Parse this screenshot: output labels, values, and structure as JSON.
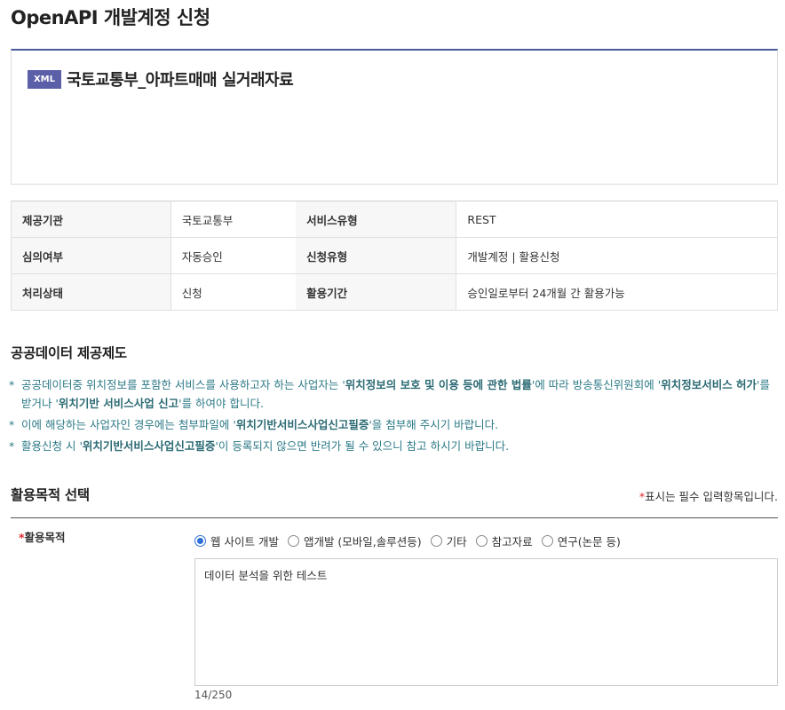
{
  "page": {
    "title": "OpenAPI 개발계정 신청"
  },
  "service": {
    "badge": "XML",
    "name": "국토교통부_아파트매매 실거래자료"
  },
  "info_table": {
    "rows": [
      {
        "label1": "제공기관",
        "value1": "국토교통부",
        "label2": "서비스유형",
        "value2": "REST"
      },
      {
        "label1": "심의여부",
        "value1": "자동승인",
        "label2": "신청유형",
        "value2": "개발계정 | 활용신청"
      },
      {
        "label1": "처리상태",
        "value1": "신청",
        "label2": "활용기간",
        "value2": "승인일로부터 24개월 간 활용가능"
      }
    ]
  },
  "policy": {
    "title": "공공데이터 제공제도",
    "star": "*",
    "notice1": {
      "t1": "공공데이터중 위치정보를 포함한 서비스를 사용하고자 하는 사업자는 '",
      "b1": "위치정보의 보호 및 이용 등에 관한 법률",
      "t2": "'에 따라 방송통신위원회에 '",
      "b2": "위치정보서비스 허가",
      "t3": "'를 받거나 '",
      "b3": "위치기반 서비스사업 신고",
      "t4": "'를 하여야 합니다."
    },
    "notice2": {
      "t1": "이에 해당하는 사업자인 경우에는 첨부파일에 '",
      "b1": "위치기반서비스사업신고필증",
      "t2": "'을 첨부해 주시기 바랍니다."
    },
    "notice3": {
      "t1": "활용신청 시 '",
      "b1": "위치기반서비스사업신고필증",
      "t2": "'이 등록되지 않으면 반려가 될 수 있으니 참고 하시기 바랍니다."
    }
  },
  "purpose": {
    "section_title": "활용목적 선택",
    "required_star": "*",
    "required_note": "표시는 필수 입력항목입니다.",
    "field_label": "활용목적",
    "options": [
      "웹 사이트 개발",
      "앱개발 (모바일,솔루션등)",
      "기타",
      "참고자료",
      "연구(논문 등)"
    ],
    "selected": "웹 사이트 개발",
    "text_value": "데이터 분석을 위한 테스트",
    "counter": "14/250"
  },
  "colors": {
    "accent": "#4a5a9b",
    "badge": "#5b5fa8",
    "notice": "#2d7a87",
    "required": "#e0282e",
    "radio": "#2d6fd6"
  }
}
